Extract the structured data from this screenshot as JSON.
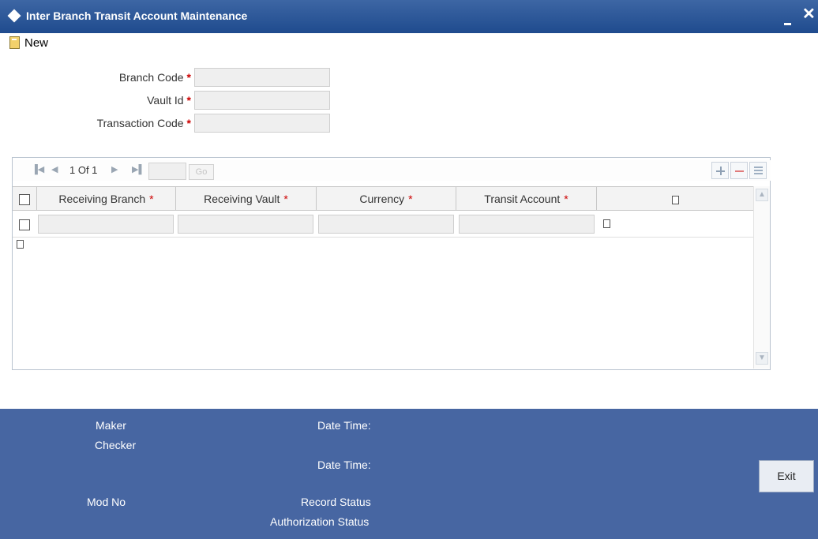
{
  "window": {
    "title": "Inter Branch Transit Account Maintenance",
    "minimize_glyph": "_",
    "close_glyph": "✕"
  },
  "toolbar": {
    "new_label": "New"
  },
  "form": {
    "branch_code": {
      "label": "Branch Code",
      "required": "*",
      "value": ""
    },
    "vault_id": {
      "label": "Vault Id",
      "required": "*",
      "value": ""
    },
    "transaction_code": {
      "label": "Transaction Code",
      "required": "*",
      "value": ""
    }
  },
  "pager": {
    "first": "▐◀",
    "prev": "◀",
    "text": "1 Of 1",
    "next": "▶",
    "last": "▶▌",
    "go_label": "Go",
    "page_input": ""
  },
  "grid": {
    "columns": [
      {
        "label": "Receiving Branch",
        "required": "*"
      },
      {
        "label": "Receiving Vault",
        "required": "*"
      },
      {
        "label": "Currency",
        "required": "*"
      },
      {
        "label": "Transit Account",
        "required": "*"
      }
    ],
    "rows": [
      {
        "receiving_branch": "",
        "receiving_vault": "",
        "currency": "",
        "transit_account": ""
      }
    ]
  },
  "footer": {
    "maker": "Maker",
    "checker": "Checker",
    "date_time_1": "Date Time:",
    "date_time_2": "Date Time:",
    "mod_no": "Mod No",
    "record_status": "Record Status",
    "authorization_status": "Authorization Status",
    "exit_label": "Exit"
  },
  "colors": {
    "titlebar": "#1f4b8e",
    "footer": "#4766a2",
    "required": "#cc0000"
  },
  "icons": [
    "diamond-icon",
    "minimize-icon",
    "close-icon",
    "new-document-icon",
    "first-page-icon",
    "prev-page-icon",
    "next-page-icon",
    "last-page-icon",
    "add-row-icon",
    "delete-row-icon",
    "single-view-icon",
    "scroll-up-icon",
    "scroll-down-icon"
  ]
}
